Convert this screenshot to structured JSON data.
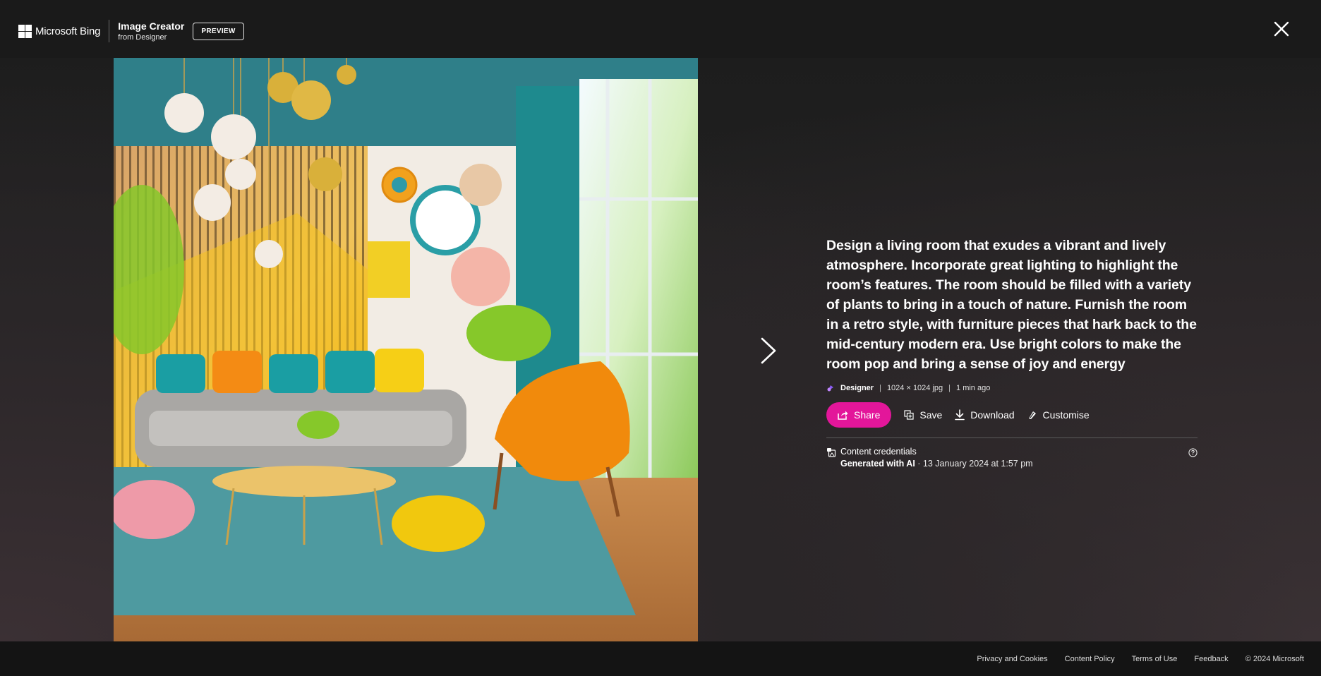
{
  "header": {
    "brand": "Microsoft Bing",
    "product_title": "Image Creator",
    "product_subtitle": "from Designer",
    "badge": "PREVIEW",
    "close_icon": "close-icon"
  },
  "image": {
    "alt": "AI-generated retro mid-century living room with vibrant colors, plants and gold pendant lights",
    "navigation": {
      "next_icon": "chevron-right-icon"
    }
  },
  "details": {
    "prompt": "Design a living room that exudes a vibrant and lively atmosphere. Incorporate great lighting to highlight the room’s features. The room should be filled with a variety of plants to bring in a touch of nature. Furnish the room in a retro style, with furniture pieces that hark back to the mid-century modern era. Use bright colors to make the room pop and bring a sense of joy and energy",
    "meta": {
      "source": "Designer",
      "size": "1024 × 1024 jpg",
      "time": "1 min ago"
    },
    "actions": {
      "share": "Share",
      "save": "Save",
      "download": "Download",
      "customise": "Customise"
    },
    "credentials": {
      "title": "Content credentials",
      "generated": "Generated with AI",
      "date": " · 13 January 2024 at 1:57 pm"
    }
  },
  "footer": {
    "links": [
      "Privacy and Cookies",
      "Content Policy",
      "Terms of Use",
      "Feedback"
    ],
    "copyright": "© 2024 Microsoft"
  },
  "colors": {
    "accent": "#e3169a",
    "header_bg": "#1a1a1a",
    "footer_bg": "#141414"
  }
}
